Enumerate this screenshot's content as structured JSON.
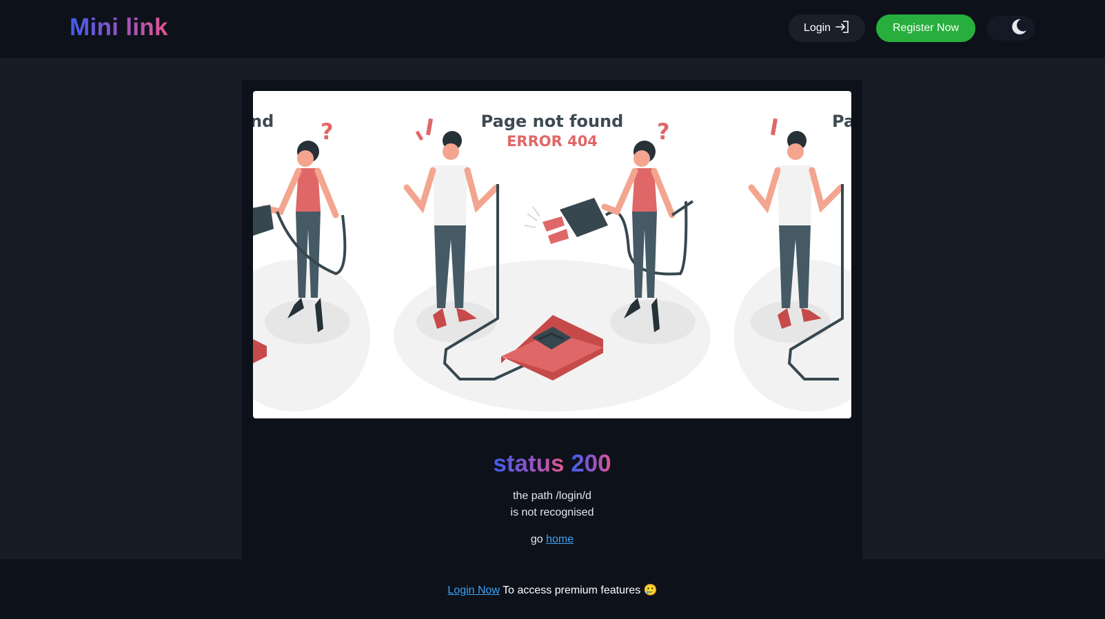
{
  "header": {
    "logo": "Mini link",
    "login_label": "Login",
    "register_label": "Register Now",
    "theme_icon": "moon-icon"
  },
  "illustration": {
    "title": "Page not found",
    "code": "ERROR 404",
    "partial_left": "nd",
    "partial_right": "Pa"
  },
  "main": {
    "status_word": "status",
    "status_code": "200",
    "path_line": "the path /login/d",
    "message_line": "is not recognised",
    "go_prefix": "go",
    "home_link": "home"
  },
  "footer": {
    "login_link": "Login Now",
    "message": "To access premium features",
    "emoji": "🥲"
  },
  "colors": {
    "accent_green": "#27ae3c",
    "link_blue": "#3ea3f5",
    "gradient_start": "#3f5ee8",
    "gradient_end": "#e2568f",
    "illustration_red": "#e06767"
  }
}
